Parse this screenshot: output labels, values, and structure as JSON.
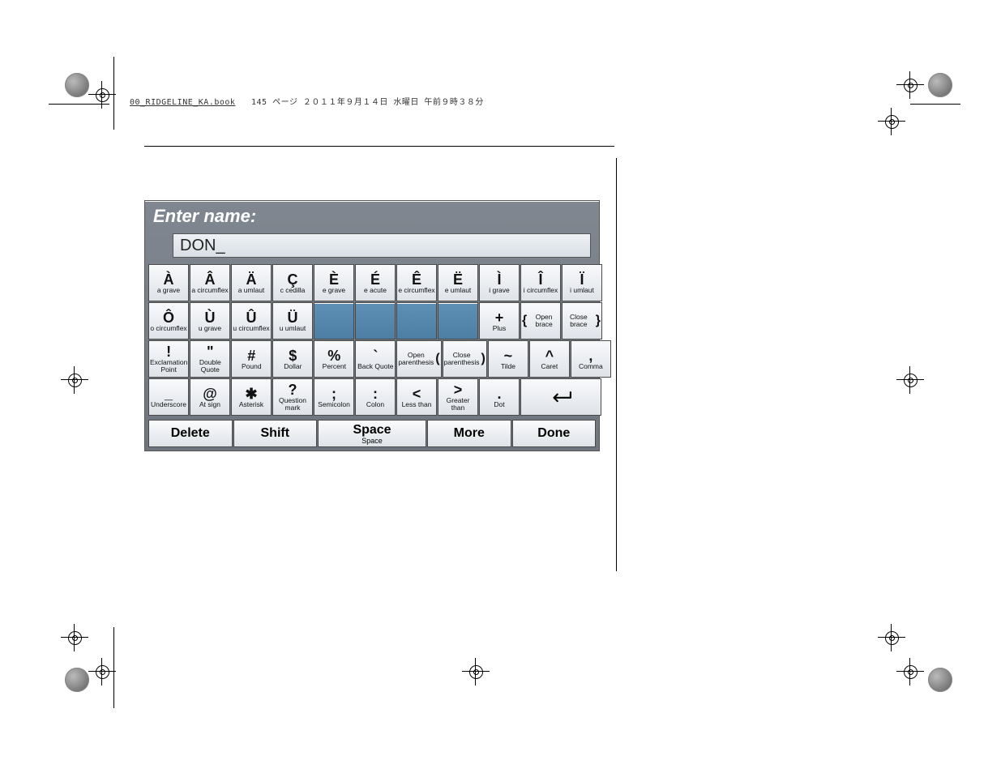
{
  "header": {
    "filename": "00_RIDGELINE_KA.book",
    "page_info": "145 ページ  ２０１１年９月１４日  水曜日  午前９時３８分"
  },
  "panel": {
    "title": "Enter name:",
    "input_value": "DON_"
  },
  "rows": [
    [
      {
        "glyph": "À",
        "label": "a grave"
      },
      {
        "glyph": "Â",
        "label": "a circumflex"
      },
      {
        "glyph": "Ä",
        "label": "a umlaut"
      },
      {
        "glyph": "Ç",
        "label": "c cedilla"
      },
      {
        "glyph": "È",
        "label": "e grave"
      },
      {
        "glyph": "É",
        "label": "e acute"
      },
      {
        "glyph": "Ê",
        "label": "e circumflex"
      },
      {
        "glyph": "Ë",
        "label": "e umlaut"
      },
      {
        "glyph": "Ì",
        "label": "i grave"
      },
      {
        "glyph": "Î",
        "label": "i circumflex"
      },
      {
        "glyph": "Ï",
        "label": "i umlaut"
      }
    ],
    [
      {
        "glyph": "Ô",
        "label": "o circumflex"
      },
      {
        "glyph": "Ù",
        "label": "u grave"
      },
      {
        "glyph": "Û",
        "label": "u circumflex"
      },
      {
        "glyph": "Ü",
        "label": "u umlaut"
      },
      {
        "blank": true
      },
      {
        "blank": true
      },
      {
        "blank": true
      },
      {
        "blank": true
      },
      {
        "glyph": "+",
        "label": "Plus"
      },
      {
        "glyph": "{",
        "label": "Open brace",
        "side": "left"
      },
      {
        "glyph": "}",
        "label": "Close brace",
        "side": "right"
      }
    ],
    [
      {
        "glyph": "!",
        "label": "Exclamation Point"
      },
      {
        "glyph": "\"",
        "label": "Double Quote"
      },
      {
        "glyph": "#",
        "label": "Pound"
      },
      {
        "glyph": "$",
        "label": "Dollar"
      },
      {
        "glyph": "%",
        "label": "Percent"
      },
      {
        "glyph": "`",
        "label": "Back Quote"
      },
      {
        "glyph": "(",
        "label": "Open parenthesis",
        "side": "right"
      },
      {
        "glyph": ")",
        "label": "Close parenthesis",
        "side": "right"
      },
      {
        "glyph": "~",
        "label": "Tilde"
      },
      {
        "glyph": "^",
        "label": "Caret"
      },
      {
        "glyph": ",",
        "label": "Comma"
      }
    ],
    [
      {
        "glyph": "_",
        "label": "Underscore"
      },
      {
        "glyph": "@",
        "label": "At sign"
      },
      {
        "glyph": "✱",
        "label": "Asterisk"
      },
      {
        "glyph": "?",
        "label": "Question mark"
      },
      {
        "glyph": ";",
        "label": "Semicolon"
      },
      {
        "glyph": ":",
        "label": "Colon"
      },
      {
        "glyph": "<",
        "label": "Less than"
      },
      {
        "glyph": ">",
        "label": "Greater than"
      },
      {
        "glyph": ".",
        "label": "Dot"
      },
      {
        "enter": true
      }
    ]
  ],
  "actions": {
    "delete": "Delete",
    "shift": "Shift",
    "space": "Space",
    "space_sub": "Space",
    "more": "More",
    "done": "Done"
  }
}
